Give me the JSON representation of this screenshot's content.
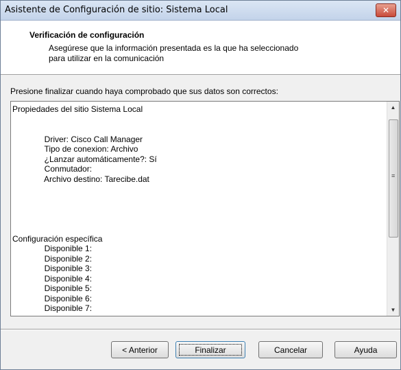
{
  "window": {
    "title": "Asistente de Configuración de sitio: Sistema Local",
    "close_glyph": "✕"
  },
  "header": {
    "title": "Verificación de configuración",
    "subtitle": "Asegúrese que la información presentada es la que ha seleccionado\npara utilizar en la comunicación"
  },
  "instruction": "Presione finalizar cuando haya comprobado que sus datos son correctos:",
  "details": {
    "text": "Propiedades del sitio Sistema Local\n\n\n              Driver: Cisco Call Manager\n              Tipo de conexion: Archivo\n              ¿Lanzar automáticamente?: Sí\n              Conmutador:\n              Archivo destino: Tarecibe.dat\n\n\n\n\n\nConfiguración específica\n              Disponible 1:\n              Disponible 2:\n              Disponible 3:\n              Disponible 4:\n              Disponible 5:\n              Disponible 6:\n              Disponible 7:"
  },
  "scrollbar": {
    "up_glyph": "▲",
    "down_glyph": "▼",
    "grip_glyph": "≡"
  },
  "buttons": {
    "back": "< Anterior",
    "finish": "Finalizar",
    "cancel": "Cancelar",
    "help": "Ayuda"
  }
}
